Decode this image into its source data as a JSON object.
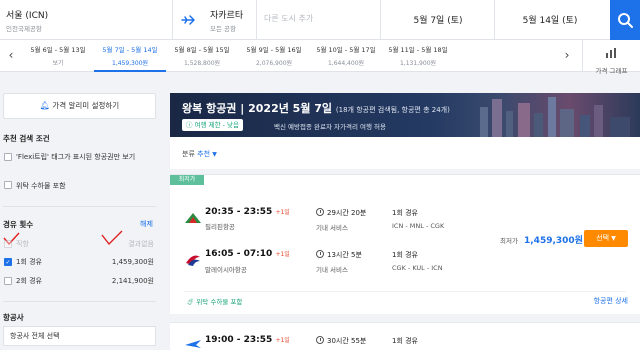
{
  "search": {
    "origin": {
      "code": "서울 (ICN)",
      "airport": "인천국제공항"
    },
    "destination": {
      "code": "자카르타",
      "airport": "모든 공항"
    },
    "multi_city_placeholder": "다른 도시 추가",
    "depart_date": "5월 7일 (토)",
    "return_date": "5월 14일 (토)"
  },
  "date_strip": {
    "cells": [
      {
        "range": "5월 6일 - 5월 13일",
        "price": "보기"
      },
      {
        "range": "5월 7일 - 5월 14일",
        "price": "1,459,300원"
      },
      {
        "range": "5월 8일 - 5월 15일",
        "price": "1,528,800원"
      },
      {
        "range": "5월 9일 - 5월 16일",
        "price": "2,076,900원"
      },
      {
        "range": "5월 10일 - 5월 17일",
        "price": "1,644,400원"
      },
      {
        "range": "5월 11일 - 5월 18일",
        "price": "1,131,900원"
      }
    ],
    "selected_index": 1,
    "prev_icon": "‹",
    "next_icon": "›",
    "price_graph_label": "가격 그래프"
  },
  "left": {
    "alarm_label": "가격 알리미 설정하기",
    "recommend_title": "추천 검색 조건",
    "recommend_options": [
      "'Flexi트립' 태그가 표시된 항공권만 보기",
      "위탁 수하물 포함"
    ],
    "stops_title": "경유 횟수",
    "stops_clear": "해제",
    "stops_options": [
      {
        "label": "직항",
        "price": "결과없음",
        "checked": false,
        "dim": true
      },
      {
        "label": "1회 경유",
        "price": "1,459,300원",
        "checked": true,
        "dim": false
      },
      {
        "label": "2회 경유",
        "price": "2,141,900원",
        "checked": false,
        "dim": false
      }
    ],
    "airline_title": "항공사",
    "airline_select": "항공사 전체 선택"
  },
  "banner": {
    "title_main": "왕복 항공권  |  2022년 5월 7일",
    "title_small": "(18개 항공편 검색됨, 항공편 총 24개)",
    "travel_badge": "여행 제한 - 낮음",
    "travel_note": "백신 예방접종 완료자 자가격리 여행 허용"
  },
  "sort": {
    "label": "분류",
    "value": "추천"
  },
  "result": {
    "badge": "최저가",
    "legs": [
      {
        "times": "20:35 - 23:55",
        "plus": "+1일",
        "airline": "필리핀항공",
        "duration": "29시간 20분",
        "service": "기내 서비스",
        "stops": "1회 경유",
        "route": "ICN - MNL - CGK"
      },
      {
        "times": "16:05 - 07:10",
        "plus": "+1일",
        "airline": "말레이시아항공",
        "duration": "13시간 5분",
        "service": "기내 서비스",
        "stops": "1회 경유",
        "route": "CGK - KUL - ICN"
      }
    ],
    "price_label": "최저가",
    "price": "1,459,300원",
    "choose_label": "선택",
    "free_bag": "위탁 수하물 포함",
    "detail_link": "항공편 상세"
  },
  "result2": {
    "times": "19:00 - 23:55",
    "plus": "+1일",
    "duration": "30시간 55분",
    "stops": "1회 경유"
  },
  "colors": {
    "accent": "#1d71e9",
    "select_button": "#ff8a00",
    "low_badge": "#5dc09b",
    "plus_day": "#e6452c"
  }
}
